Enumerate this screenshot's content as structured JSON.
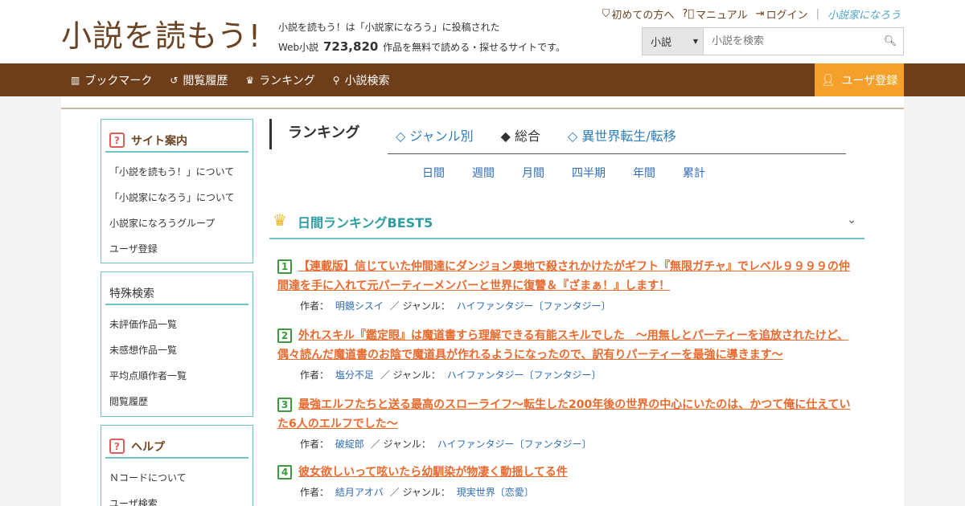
{
  "header": {
    "logo": "小説を読もう!",
    "tagline_line1": "小説を読もう！は「小説家になろう」に投稿された",
    "tagline_prefix": "Web小説",
    "tagline_count": "723,820",
    "tagline_suffix": "作品を無料で読める・探せるサイトです。",
    "links": [
      "初めての方へ",
      "マニュアル",
      "ログイン"
    ],
    "narou_logo": "小説家になろう",
    "search_select": "小説",
    "search_placeholder": "小説を検索"
  },
  "nav": {
    "items": [
      "ブックマーク",
      "閲覧履歴",
      "ランキング",
      "小説検索"
    ],
    "register": "ユーザ登録"
  },
  "sidebar": {
    "site_guide": {
      "title": "サイト案内",
      "items": [
        "「小説を読もう！」について",
        "「小説家になろう」について",
        "小説家になろうグループ",
        "ユーザ登録"
      ]
    },
    "special_search": {
      "title": "特殊検索",
      "items": [
        "未評価作品一覧",
        "未感想作品一覧",
        "平均点順作者一覧",
        "閲覧履歴"
      ]
    },
    "help": {
      "title": "ヘルプ",
      "items": [
        "Ｎコードについて",
        "ユーザ検索"
      ]
    }
  },
  "main": {
    "title": "ランキング",
    "tabs": [
      "◇ ジャンル別",
      "◆ 総合",
      "◇ 異世界転生/転移"
    ],
    "periods": [
      "日間",
      "週間",
      "月間",
      "四半期",
      "年間",
      "累計"
    ],
    "best_title": "日間ランキングBEST5",
    "author_label": "作者：",
    "genre_label": "／ ジャンル：",
    "entries": [
      {
        "rank": "1",
        "title": "【連載版】信じていた仲間達にダンジョン奥地で殺されかけたがギフト『無限ガチャ』でレベル９９９９の仲間達を手に入れて元パーティーメンバーと世界に復讐＆『ざまぁ！』します！",
        "author": "明鏡シスイ",
        "genre": "ハイファンタジー〔ファンタジー〕"
      },
      {
        "rank": "2",
        "title": "外れスキル『鑑定眼』は魔道書すら理解できる有能スキルでした　～用無しとパーティーを追放されたけど、偶々読んだ魔道書のお陰で魔道具が作れるようになったので、訳有りパーティーを最強に導きます～",
        "author": "塩分不足",
        "genre": "ハイファンタジー〔ファンタジー〕"
      },
      {
        "rank": "3",
        "title": "最強エルフたちと送る最高のスローライフ～転生した200年後の世界の中心にいたのは、かつて俺に仕えていた6人のエルフでした～",
        "author": "破綻郎",
        "genre": "ハイファンタジー〔ファンタジー〕"
      },
      {
        "rank": "4",
        "title": "彼女欲しいって呟いたら幼馴染が物凄く動揺してる件",
        "author": "結月アオバ",
        "genre": "現実世界〔恋愛〕"
      }
    ]
  }
}
